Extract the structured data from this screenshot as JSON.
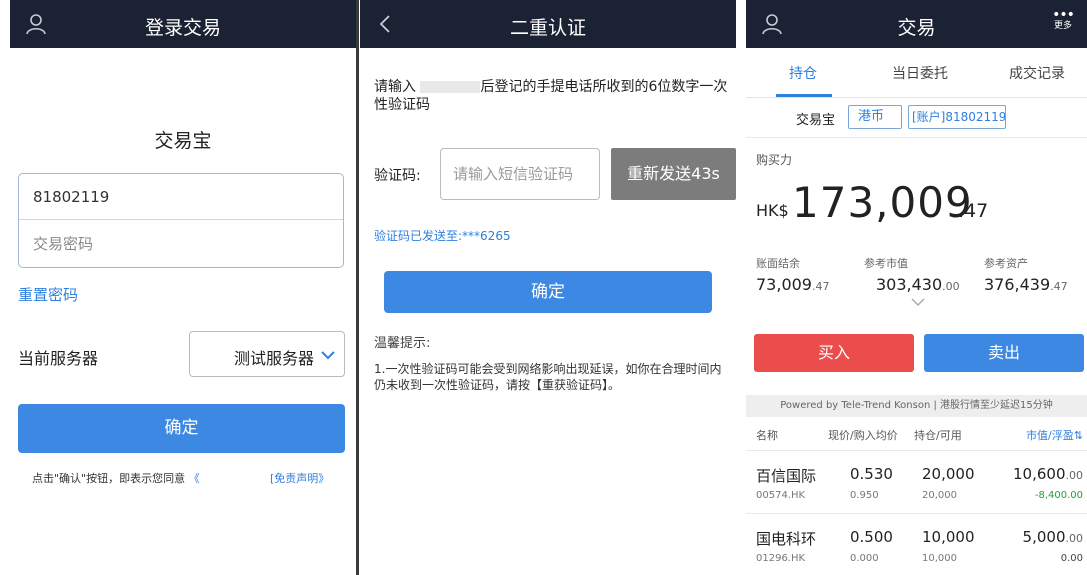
{
  "colors": {
    "topbar": "#1b2234",
    "primary": "#3c88e2",
    "buy": "#eb4d4d",
    "disabled": "#7c7c7c",
    "link": "#2f80e0",
    "loss": "#1fa33b"
  },
  "login": {
    "title": "登录交易",
    "user_icon": "user-icon",
    "brand": "交易宝",
    "account_value": "81802119",
    "password_placeholder": "交易密码",
    "reset_link": "重置密码",
    "server_label": "当前服务器",
    "server_value": "测试服务器",
    "confirm": "确定",
    "agreement_text": "点击\"确认\"按钮，即表示您同意",
    "agreement_link": "《",
    "disclaimer_link": "[免责声明》"
  },
  "verify": {
    "title": "二重认证",
    "back_icon": "back-arrow-icon",
    "instruction_pre": "请输入",
    "instruction_post": "后登记的手提电话所收到的6位数字一次性验证码",
    "code_label": "验证码:",
    "code_placeholder": "请输入短信验证码",
    "resend": "重新发送43s",
    "sent_to": "验证码已发送至:***6265",
    "confirm": "确定",
    "tip_title": "温馨提示:",
    "tip_body": "1.一次性验证码可能会受到网络影响出现延误，如你在合理时间内仍未收到一次性验证码，请按【重获验证码】。"
  },
  "trade": {
    "title": "交易",
    "more_label": "更多",
    "tabs": [
      "持仓",
      "当日委托",
      "成交记录"
    ],
    "account_name": "交易宝",
    "currency": "港币",
    "account_no": "[账户]81802119",
    "buying_power_label": "购买力",
    "currency_code": "HK$",
    "buying_power": "173,009",
    "buying_power_dec": ".47",
    "stats": [
      {
        "label": "账面结余",
        "value": "73,009",
        "dec": ".47"
      },
      {
        "label": "参考市值",
        "value": "303,430",
        "dec": ".00"
      },
      {
        "label": "参考资产",
        "value": "376,439",
        "dec": ".47"
      }
    ],
    "buy": "买入",
    "sell": "卖出",
    "powered_by": "Powered by Tele-Trend Konson | 港股行情至少延迟15分钟",
    "table_headers": {
      "name": "名称",
      "price": "现价/购入均价",
      "qty": "持仓/可用",
      "mv": "市值/浮盈⇅"
    },
    "holdings": [
      {
        "name": "百信国际",
        "code": "00574.HK",
        "price": "0.530",
        "cost": "0.950",
        "qty": "20,000",
        "avail": "20,000",
        "mv": "10,600",
        "mv_dec": ".00",
        "pl": "-8,400.00"
      },
      {
        "name": "国电科环",
        "code": "01296.HK",
        "price": "0.500",
        "cost": "0.000",
        "qty": "10,000",
        "avail": "10,000",
        "mv": "5,000",
        "mv_dec": ".00",
        "pl": "0.00"
      }
    ]
  }
}
